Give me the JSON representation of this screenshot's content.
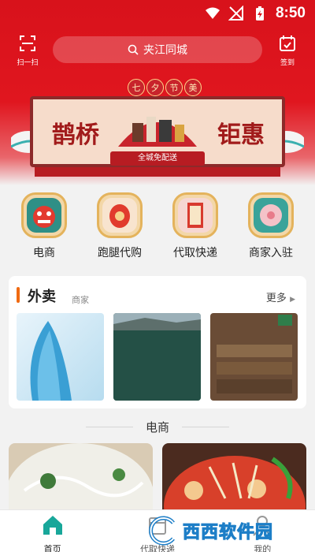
{
  "status_bar": {
    "time": "8:50"
  },
  "header": {
    "scan_label": "扫一扫",
    "sign_label": "签到",
    "search_placeholder": "夹江同城"
  },
  "banner": {
    "tag_chars": [
      "七",
      "夕",
      "节",
      "美"
    ],
    "left_title": "鹊桥",
    "right_title": "钜惠",
    "subtitle": "全城免配送"
  },
  "categories": [
    {
      "label": "电商",
      "icon": "lion-dance-icon"
    },
    {
      "label": "跑腿代购",
      "icon": "lantern-icon"
    },
    {
      "label": "代取快递",
      "icon": "fortune-slip-icon"
    },
    {
      "label": "商家入驻",
      "icon": "flower-icon"
    }
  ],
  "waimai": {
    "title": "外卖",
    "subtitle": "商家",
    "more": "更多"
  },
  "section": {
    "title": "电商"
  },
  "bottom_nav": [
    {
      "label": "首页",
      "icon": "home-icon"
    },
    {
      "label": "代取快递",
      "icon": "package-icon"
    },
    {
      "label": "我的",
      "icon": "user-icon"
    }
  ],
  "watermark": {
    "text": "西西软件园"
  },
  "colors": {
    "brand_red": "#d8121b",
    "accent_orange": "#f06a12",
    "home_teal": "#18a79a"
  }
}
